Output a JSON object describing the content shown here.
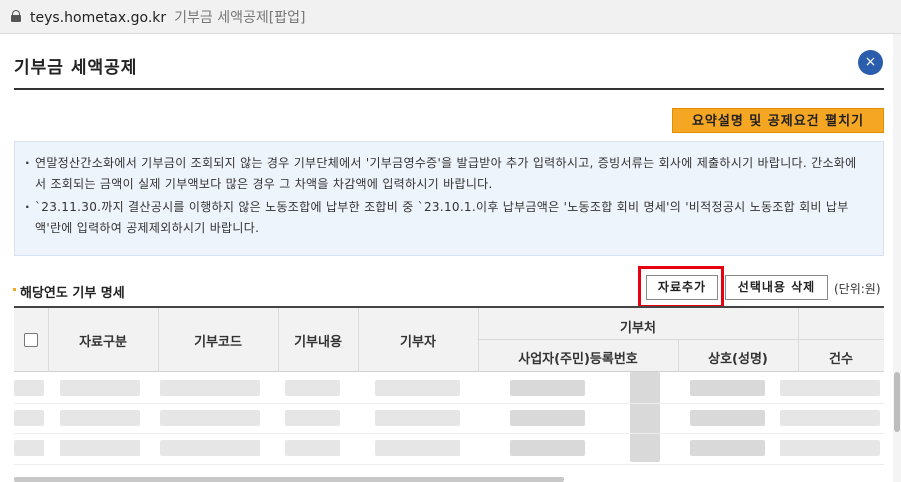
{
  "browser": {
    "url": "teys.hometax.go.kr",
    "window_title": "기부금 세액공제[팝업]"
  },
  "popup": {
    "title": "기부금 세액공제",
    "close_label": "×"
  },
  "summary_button_label": "요약설명 및 공제요건 펼치기",
  "notice": {
    "items": [
      "연말정산간소화에서 기부금이 조회되지 않는 경우 기부단체에서 '기부금영수증'을 발급받아 추가 입력하시고, 증빙서류는 회사에 제출하시기 바랍니다. 간소화에서 조회되는 금액이 실제 기부액보다 많은 경우 그 차액을 차감액에 입력하시기 바랍니다.",
      "`23.11.30.까지 결산공시를 이행하지 않은 노동조합에 납부한 조합비 중 `23.10.1.이후 납부금액은 '노동조합 회비 명세'의 '비적정공시 노동조합 회비 납부액'란에 입력하여 공제제외하시기 바랍니다."
    ]
  },
  "section": {
    "title": "해당연도 기부 명세",
    "add_button": "자료추가",
    "delete_button": "선택내용 삭제",
    "unit": "(단위:원)"
  },
  "table": {
    "headers": {
      "data_type": "자료구분",
      "donation_code": "기부코드",
      "donation_content": "기부내용",
      "donor": "기부자",
      "recipient": "기부처",
      "business_no": "사업자(주민)등록번호",
      "name": "상호(성명)",
      "count": "건수"
    }
  },
  "colors": {
    "accent_orange": "#f5a623",
    "close_blue": "#2a5dab",
    "highlight_red": "#e60012"
  }
}
